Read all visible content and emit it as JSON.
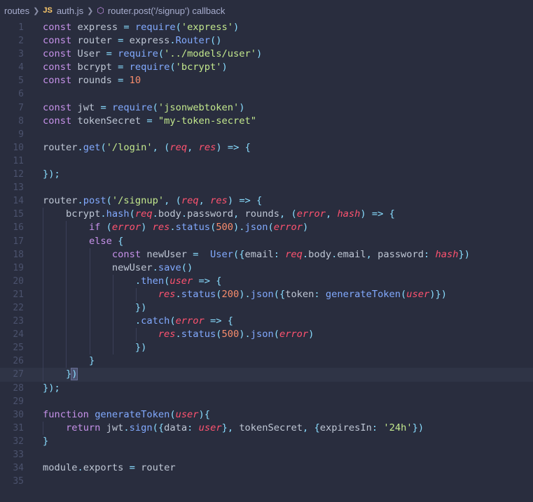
{
  "breadcrumb": {
    "folder": "routes",
    "file_badge": "JS",
    "file": "auth.js",
    "symbol": "router.post('/signup') callback"
  },
  "editor": {
    "language": "javascript",
    "active_line": 27,
    "line_numbers": [
      "1",
      "2",
      "3",
      "4",
      "5",
      "6",
      "7",
      "8",
      "9",
      "10",
      "11",
      "12",
      "13",
      "14",
      "15",
      "16",
      "17",
      "18",
      "19",
      "20",
      "21",
      "22",
      "23",
      "24",
      "25",
      "26",
      "27",
      "28",
      "29",
      "30",
      "31",
      "32",
      "33",
      "34",
      "35"
    ],
    "lines": [
      "const express = require('express')",
      "const router = express.Router()",
      "const User = require('../models/user')",
      "const bcrypt = require('bcrypt')",
      "const rounds = 10",
      "",
      "const jwt = require('jsonwebtoken')",
      "const tokenSecret = \"my-token-secret\"",
      "",
      "router.get('/login', (req, res) => {",
      "",
      "});",
      "",
      "router.post('/signup', (req, res) => {",
      "    bcrypt.hash(req.body.password, rounds, (error, hash) => {",
      "        if (error) res.status(500).json(error)",
      "        else {",
      "            const newUser =  User({email: req.body.email, password: hash})",
      "            newUser.save()",
      "                .then(user => {",
      "                    res.status(200).json({token: generateToken(user)})",
      "                })",
      "                .catch(error => {",
      "                    res.status(500).json(error)",
      "                })",
      "        }",
      "    })",
      "});",
      "",
      "function generateToken(user){",
      "    return jwt.sign({data: user}, tokenSecret, {expiresIn: '24h'})",
      "}",
      "",
      "module.exports = router",
      ""
    ]
  }
}
